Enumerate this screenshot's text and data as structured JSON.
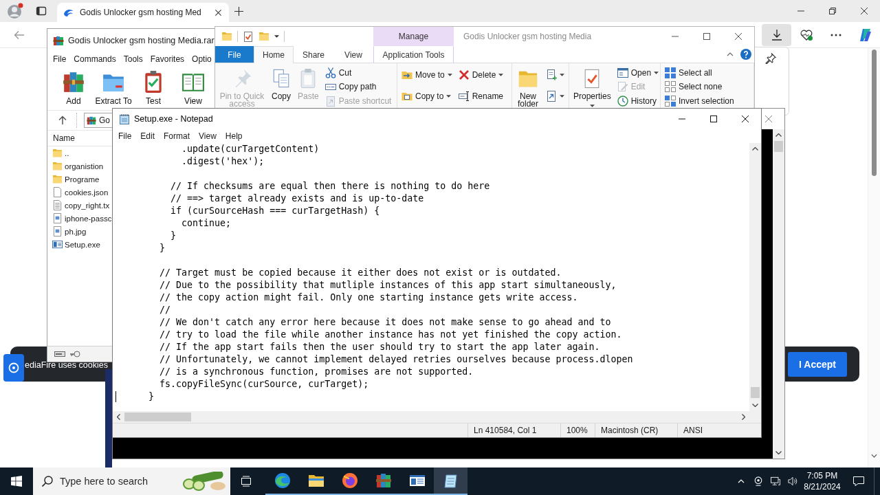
{
  "browser": {
    "tab": {
      "title": "Godis Unlocker gsm hosting Med",
      "selected": true
    },
    "cookie_banner": {
      "text": "ediaFire uses cookies",
      "button": "I Accept"
    }
  },
  "winrar": {
    "title": "Godis Unlocker gsm hosting Media.rar",
    "menu": [
      "File",
      "Commands",
      "Tools",
      "Favorites",
      "Optio"
    ],
    "toolbar": [
      "Add",
      "Extract To",
      "Test",
      "View"
    ],
    "address": "Go",
    "column": "Name",
    "files": [
      {
        "name": "..",
        "kind": "folder"
      },
      {
        "name": "organistion",
        "kind": "folder"
      },
      {
        "name": "Programe",
        "kind": "folder"
      },
      {
        "name": "cookies.json",
        "kind": "file"
      },
      {
        "name": "copy_right.tx",
        "kind": "text"
      },
      {
        "name": "iphone-passc",
        "kind": "image"
      },
      {
        "name": "ph.jpg",
        "kind": "image"
      },
      {
        "name": "Setup.exe",
        "kind": "program"
      }
    ]
  },
  "explorer": {
    "context_header": "Manage",
    "title": "Godis Unlocker gsm hosting Media",
    "tabs": [
      {
        "label": "File",
        "kind": "file",
        "selected": false
      },
      {
        "label": "Home",
        "kind": "tab",
        "selected": true
      },
      {
        "label": "Share",
        "kind": "tab",
        "selected": false
      },
      {
        "label": "View",
        "kind": "tab",
        "selected": false
      },
      {
        "label": "Application Tools",
        "kind": "context",
        "selected": false
      }
    ],
    "ribbon": [
      {
        "columns": [
          {
            "kind": "large",
            "items": [
              {
                "label": "Pin to Quick access",
                "disabled": true,
                "dropdown": false
              }
            ]
          },
          {
            "kind": "large",
            "items": [
              {
                "label": "Copy",
                "disabled": false,
                "dropdown": false
              }
            ]
          },
          {
            "kind": "large",
            "items": [
              {
                "label": "Paste",
                "disabled": true,
                "dropdown": false
              }
            ]
          },
          {
            "kind": "small",
            "items": [
              {
                "label": "Cut",
                "disabled": false,
                "dropdown": false
              },
              {
                "label": "Copy path",
                "disabled": false,
                "dropdown": false
              },
              {
                "label": "Paste shortcut",
                "disabled": true,
                "dropdown": false
              }
            ]
          }
        ]
      },
      {
        "columns": [
          {
            "kind": "small",
            "items": [
              {
                "label": "Move to",
                "disabled": false,
                "dropdown": true
              },
              {
                "label": "Copy to",
                "disabled": false,
                "dropdown": true
              }
            ]
          },
          {
            "kind": "small",
            "items": [
              {
                "label": "Delete",
                "disabled": false,
                "dropdown": true
              },
              {
                "label": "Rename",
                "disabled": false,
                "dropdown": false
              }
            ]
          }
        ]
      },
      {
        "columns": [
          {
            "kind": "large",
            "items": [
              {
                "label": "New folder",
                "disabled": false,
                "dropdown": false
              }
            ]
          },
          {
            "kind": "icons",
            "items": [
              {
                "disabled": false,
                "dropdown": true
              },
              {
                "disabled": false,
                "dropdown": true
              }
            ]
          }
        ]
      },
      {
        "columns": [
          {
            "kind": "large",
            "items": [
              {
                "label": "Properties",
                "disabled": false,
                "dropdown": true
              }
            ]
          },
          {
            "kind": "small",
            "items": [
              {
                "label": "Open",
                "disabled": false,
                "dropdown": true
              },
              {
                "label": "Edit",
                "disabled": true,
                "dropdown": false
              },
              {
                "label": "History",
                "disabled": false,
                "dropdown": false
              }
            ]
          }
        ]
      },
      {
        "columns": [
          {
            "kind": "small",
            "items": [
              {
                "label": "Select all",
                "disabled": false,
                "dropdown": false
              },
              {
                "label": "Select none",
                "disabled": false,
                "dropdown": false
              },
              {
                "label": "Invert selection",
                "disabled": false,
                "dropdown": false
              }
            ]
          }
        ]
      }
    ]
  },
  "notepad": {
    "title": "Setup.exe - Notepad",
    "menu": [
      "File",
      "Edit",
      "Format",
      "View",
      "Help"
    ],
    "text_blocks": [
      [
        "            .update(curTargetContent)",
        "            .digest('hex');"
      ],
      [
        "          // If checksums are equal then there is nothing to do here",
        "          // ==> target already exists and is up-to-date",
        "          if (curSourceHash === curTargetHash) {",
        "            continue;",
        "          }",
        "        }"
      ],
      [
        "        // Target must be copied because it either does not exist or is outdated.",
        "        // Due to the possibility that mutliple instances of this app start simultaneously,",
        "        // the copy action might fail. Only one starting instance gets write access.",
        "        //",
        "        // We don't catch any error here because it does not make sense to go ahead and to",
        "        // try to load the file while another instance has not yet finished the copy action.",
        "        // If the app start fails then the user should try to start the app later again.",
        "        // Unfortunately, we cannot implement delayed retries ourselves because process.dlopen",
        "        // is a synchronous function, promises are not supported.",
        "        fs.copyFileSync(curSource, curTarget);",
        "      }"
      ]
    ],
    "status": [
      "Ln 410584, Col 1",
      "100%",
      "Macintosh (CR)",
      "ANSI"
    ]
  },
  "taskbar": {
    "search": {
      "placeholder": "Type here to search"
    },
    "apps": [
      {
        "kind": "browser",
        "running": true,
        "selected": false
      },
      {
        "kind": "files",
        "running": true,
        "selected": false
      },
      {
        "kind": "fox",
        "running": true,
        "selected": false
      },
      {
        "kind": "archive",
        "running": true,
        "selected": false
      },
      {
        "kind": "window",
        "running": true,
        "selected": false
      },
      {
        "kind": "notepad",
        "running": true,
        "selected": true
      }
    ],
    "clock": {
      "time": "7:05 PM",
      "date": "8/21/2024"
    }
  }
}
